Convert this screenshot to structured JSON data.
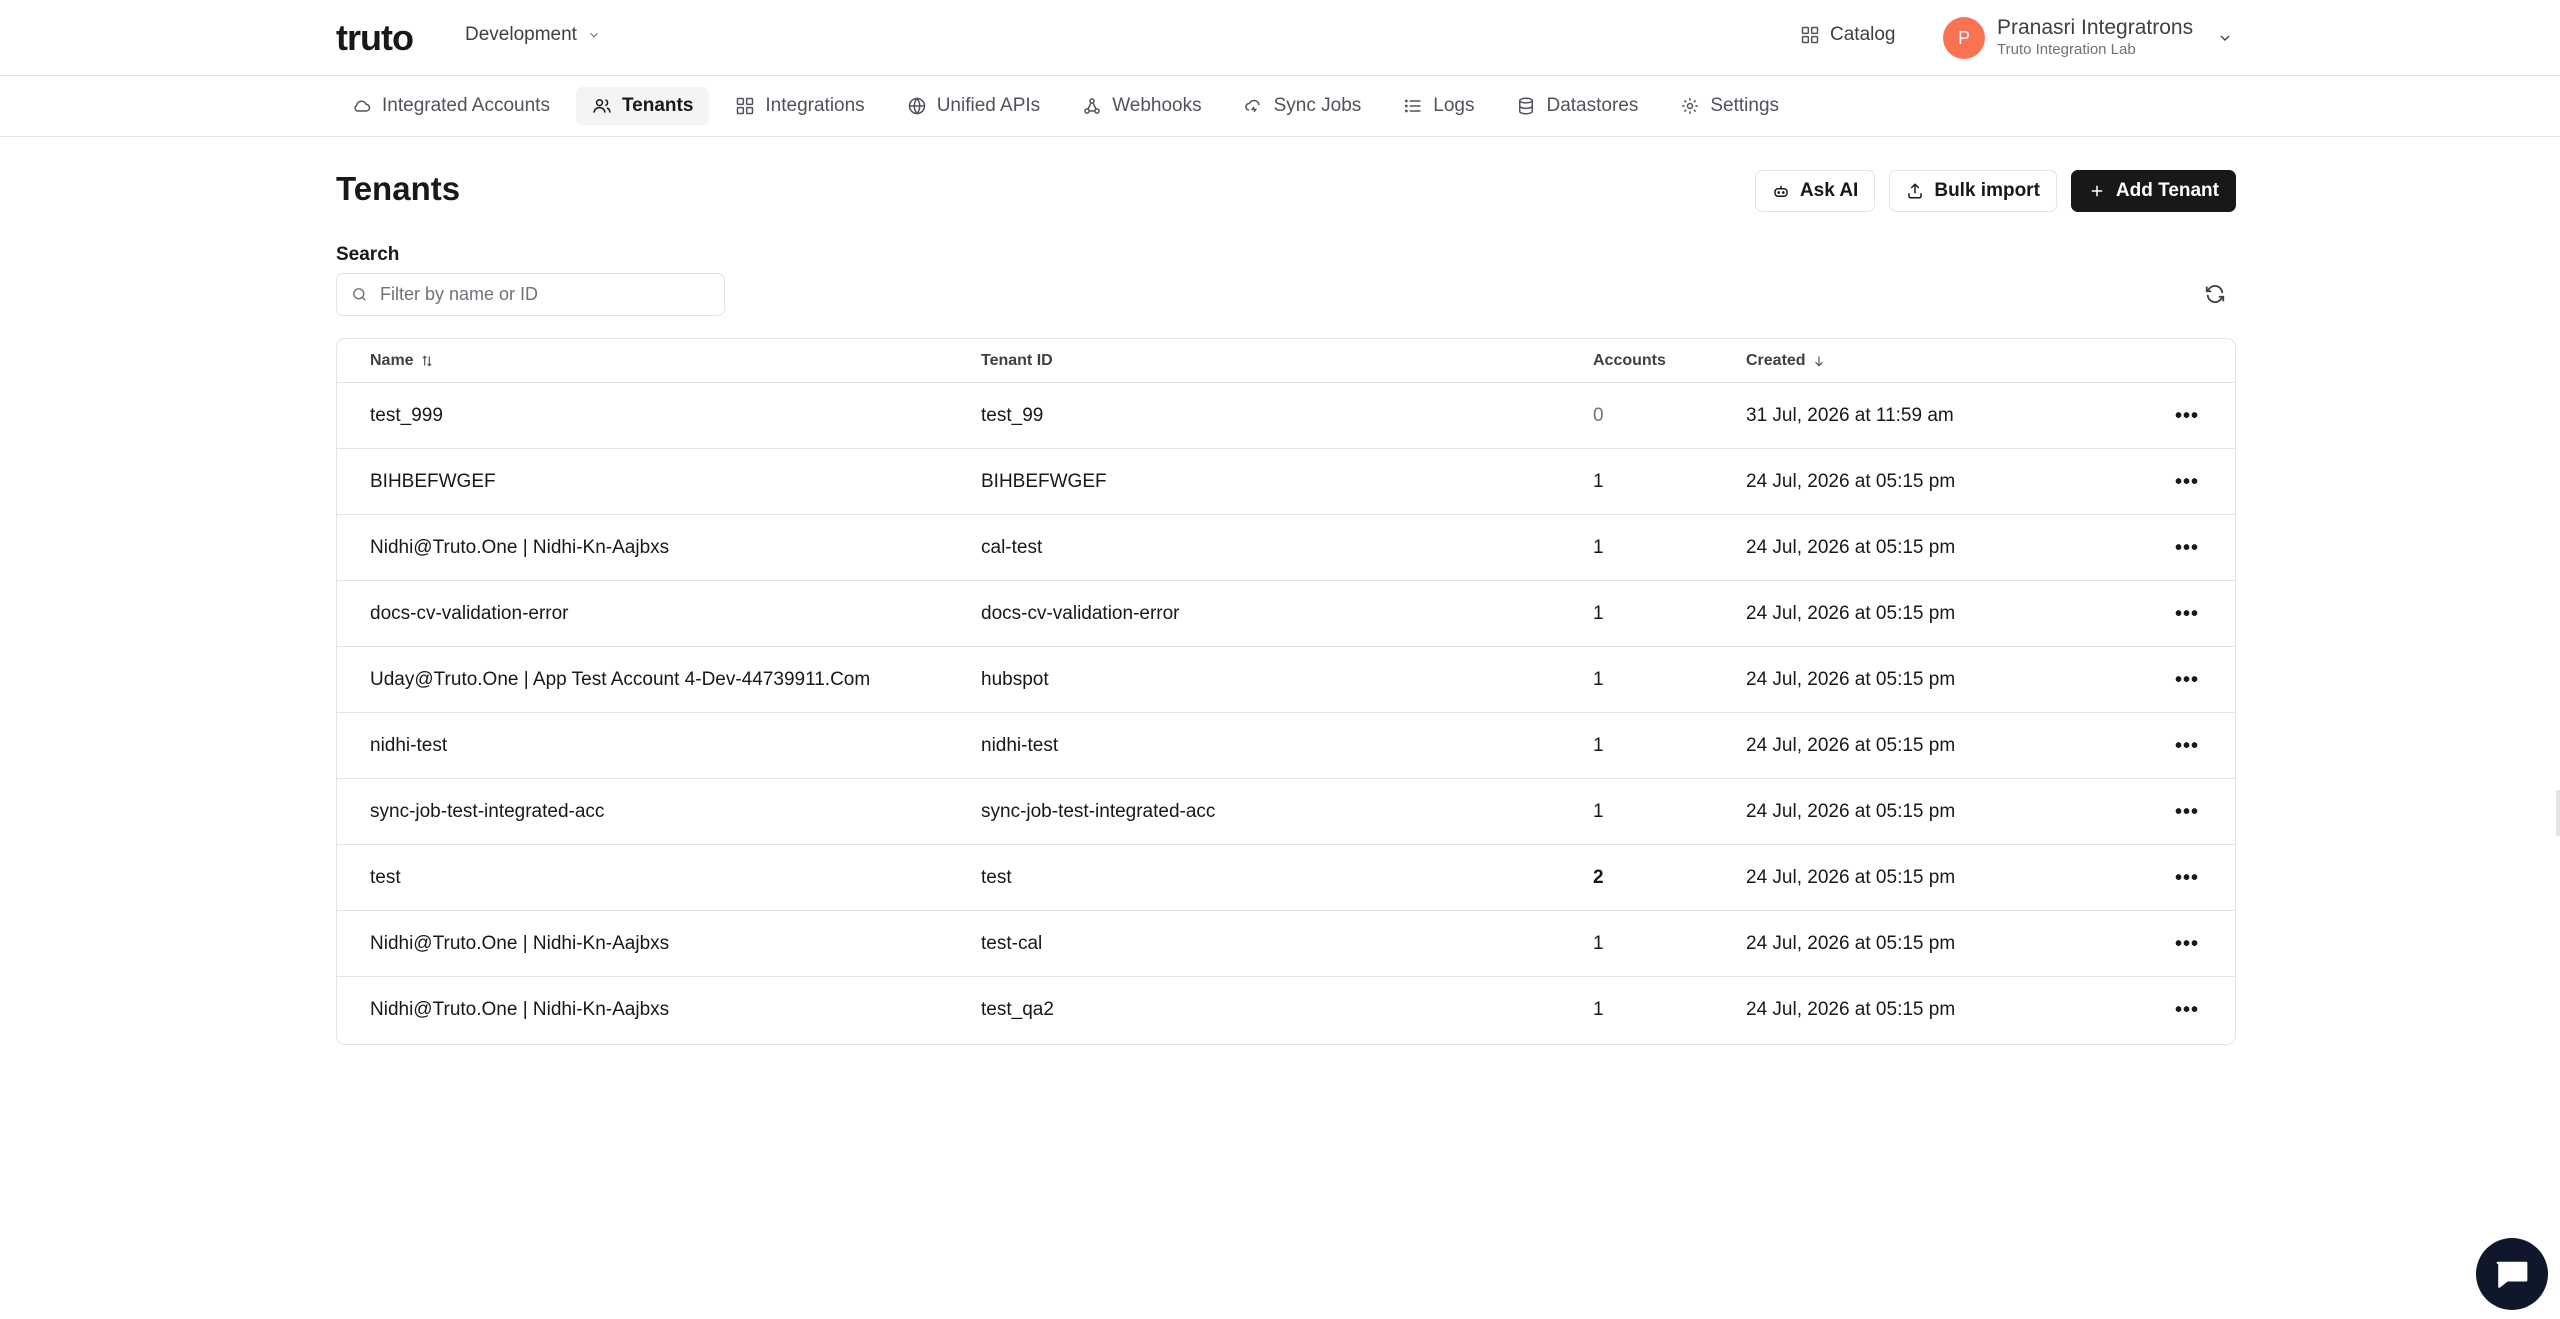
{
  "header": {
    "logo_text": "truto",
    "environment": "Development",
    "catalog_label": "Catalog",
    "user": {
      "initial": "P",
      "name": "Pranasri Integratrons",
      "org": "Truto Integration Lab"
    }
  },
  "nav": {
    "items": [
      {
        "label": "Integrated Accounts",
        "icon": "cloud-icon"
      },
      {
        "label": "Tenants",
        "icon": "users-icon",
        "active": true
      },
      {
        "label": "Integrations",
        "icon": "grid-icon"
      },
      {
        "label": "Unified APIs",
        "icon": "globe-icon"
      },
      {
        "label": "Webhooks",
        "icon": "webhook-icon"
      },
      {
        "label": "Sync Jobs",
        "icon": "cloud-sync-icon"
      },
      {
        "label": "Logs",
        "icon": "list-icon"
      },
      {
        "label": "Datastores",
        "icon": "database-icon"
      },
      {
        "label": "Settings",
        "icon": "gear-icon"
      }
    ]
  },
  "page": {
    "title": "Tenants",
    "actions": {
      "ask_ai": "Ask AI",
      "bulk_import": "Bulk import",
      "add_tenant": "Add Tenant"
    },
    "search": {
      "label": "Search",
      "placeholder": "Filter by name or ID",
      "value": ""
    }
  },
  "table": {
    "columns": {
      "name": "Name",
      "tenant_id": "Tenant ID",
      "accounts": "Accounts",
      "created": "Created"
    },
    "rows": [
      {
        "name": "test_999",
        "tenant_id": "test_99",
        "accounts": "0",
        "created": "31 Jul, 2026 at 11:59 am"
      },
      {
        "name": "BIHBEFWGEF",
        "tenant_id": "BIHBEFWGEF",
        "accounts": "1",
        "created": "24 Jul, 2026 at 05:15 pm"
      },
      {
        "name": "Nidhi@Truto.One | Nidhi-Kn-Aajbxs",
        "tenant_id": "cal-test",
        "accounts": "1",
        "created": "24 Jul, 2026 at 05:15 pm"
      },
      {
        "name": "docs-cv-validation-error",
        "tenant_id": "docs-cv-validation-error",
        "accounts": "1",
        "created": "24 Jul, 2026 at 05:15 pm"
      },
      {
        "name": "Uday@Truto.One | App Test Account 4-Dev-44739911.Com",
        "tenant_id": "hubspot",
        "accounts": "1",
        "created": "24 Jul, 2026 at 05:15 pm"
      },
      {
        "name": "nidhi-test",
        "tenant_id": "nidhi-test",
        "accounts": "1",
        "created": "24 Jul, 2026 at 05:15 pm"
      },
      {
        "name": "sync-job-test-integrated-acc",
        "tenant_id": "sync-job-test-integrated-acc",
        "accounts": "1",
        "created": "24 Jul, 2026 at 05:15 pm"
      },
      {
        "name": "test",
        "tenant_id": "test",
        "accounts": "2",
        "created": "24 Jul, 2026 at 05:15 pm"
      },
      {
        "name": "Nidhi@Truto.One | Nidhi-Kn-Aajbxs",
        "tenant_id": "test-cal",
        "accounts": "1",
        "created": "24 Jul, 2026 at 05:15 pm"
      },
      {
        "name": "Nidhi@Truto.One | Nidhi-Kn-Aajbxs",
        "tenant_id": "test_qa2",
        "accounts": "1",
        "created": "24 Jul, 2026 at 05:15 pm"
      }
    ],
    "row_menu_glyph": "•••"
  },
  "colors": {
    "avatar": "#f97352",
    "primary_button": "#18181b",
    "chat_widget": "#0f172a"
  }
}
